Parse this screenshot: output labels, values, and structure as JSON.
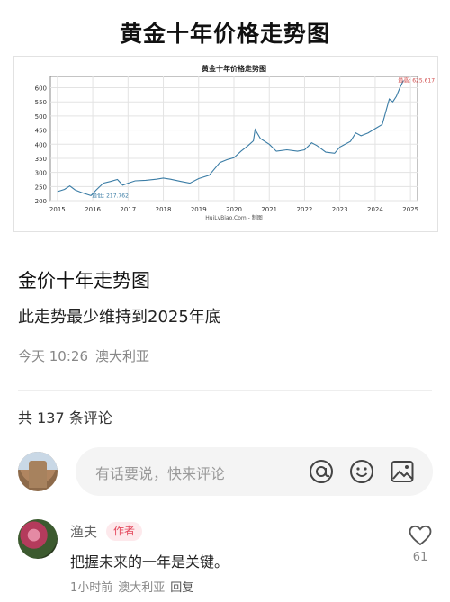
{
  "image_title": "黄金十年价格走势图",
  "chart_data": {
    "type": "line",
    "title": "黄金十年价格走势图",
    "source_label": "HuiLvBiao.Com - 制图",
    "x_ticks": [
      "2015",
      "2016",
      "2017",
      "2018",
      "2019",
      "2020",
      "2021",
      "2022",
      "2023",
      "2024",
      "2025"
    ],
    "y_ticks": [
      200,
      250,
      300,
      350,
      400,
      450,
      500,
      550,
      600
    ],
    "xlim": [
      2014.8,
      2025.2
    ],
    "ylim": [
      200,
      640
    ],
    "grid": true,
    "low_label": "最低: 217.762",
    "high_label": "最高: 625.617",
    "low_point": {
      "x": 2015.9,
      "y": 217.762
    },
    "high_point": {
      "x": 2024.8,
      "y": 625.617
    },
    "series": [
      {
        "color": "#3a7ca5",
        "points": [
          [
            2015.0,
            232
          ],
          [
            2015.2,
            240
          ],
          [
            2015.35,
            252
          ],
          [
            2015.5,
            238
          ],
          [
            2015.7,
            228
          ],
          [
            2015.85,
            222
          ],
          [
            2015.95,
            218
          ],
          [
            2016.1,
            238
          ],
          [
            2016.3,
            262
          ],
          [
            2016.5,
            268
          ],
          [
            2016.7,
            275
          ],
          [
            2016.85,
            255
          ],
          [
            2017.0,
            262
          ],
          [
            2017.2,
            270
          ],
          [
            2017.5,
            272
          ],
          [
            2017.8,
            276
          ],
          [
            2018.0,
            280
          ],
          [
            2018.2,
            276
          ],
          [
            2018.5,
            268
          ],
          [
            2018.75,
            262
          ],
          [
            2019.0,
            278
          ],
          [
            2019.3,
            290
          ],
          [
            2019.6,
            335
          ],
          [
            2019.8,
            345
          ],
          [
            2020.0,
            352
          ],
          [
            2020.2,
            375
          ],
          [
            2020.4,
            395
          ],
          [
            2020.55,
            412
          ],
          [
            2020.6,
            452
          ],
          [
            2020.75,
            420
          ],
          [
            2021.0,
            400
          ],
          [
            2021.2,
            375
          ],
          [
            2021.5,
            380
          ],
          [
            2021.8,
            375
          ],
          [
            2022.0,
            380
          ],
          [
            2022.2,
            405
          ],
          [
            2022.35,
            395
          ],
          [
            2022.6,
            372
          ],
          [
            2022.85,
            368
          ],
          [
            2023.0,
            390
          ],
          [
            2023.3,
            410
          ],
          [
            2023.45,
            440
          ],
          [
            2023.6,
            430
          ],
          [
            2023.8,
            440
          ],
          [
            2024.0,
            455
          ],
          [
            2024.2,
            470
          ],
          [
            2024.4,
            560
          ],
          [
            2024.5,
            550
          ],
          [
            2024.6,
            570
          ],
          [
            2024.7,
            600
          ],
          [
            2024.8,
            625.617
          ]
        ]
      }
    ]
  },
  "post": {
    "title": "金价十年走势图",
    "body": "此走势最少维持到2025年底",
    "time": "今天 10:26",
    "location": "澳大利亚"
  },
  "comments_count_label": "共 137 条评论",
  "input": {
    "placeholder": "有话要说，快来评论",
    "icons": [
      "at-icon",
      "emoji-icon",
      "image-icon"
    ]
  },
  "comment": {
    "author": "渔夫",
    "author_tag": "作者",
    "text": "把握未来的一年是关键。",
    "time": "1小时前",
    "location": "澳大利亚",
    "reply_label": "回复",
    "likes": "61"
  },
  "colors": {
    "line": "#3a7ca5",
    "high_label": "#d04a4a",
    "author_tag_text": "#e44a5e",
    "author_tag_bg": "#fde9ec"
  }
}
